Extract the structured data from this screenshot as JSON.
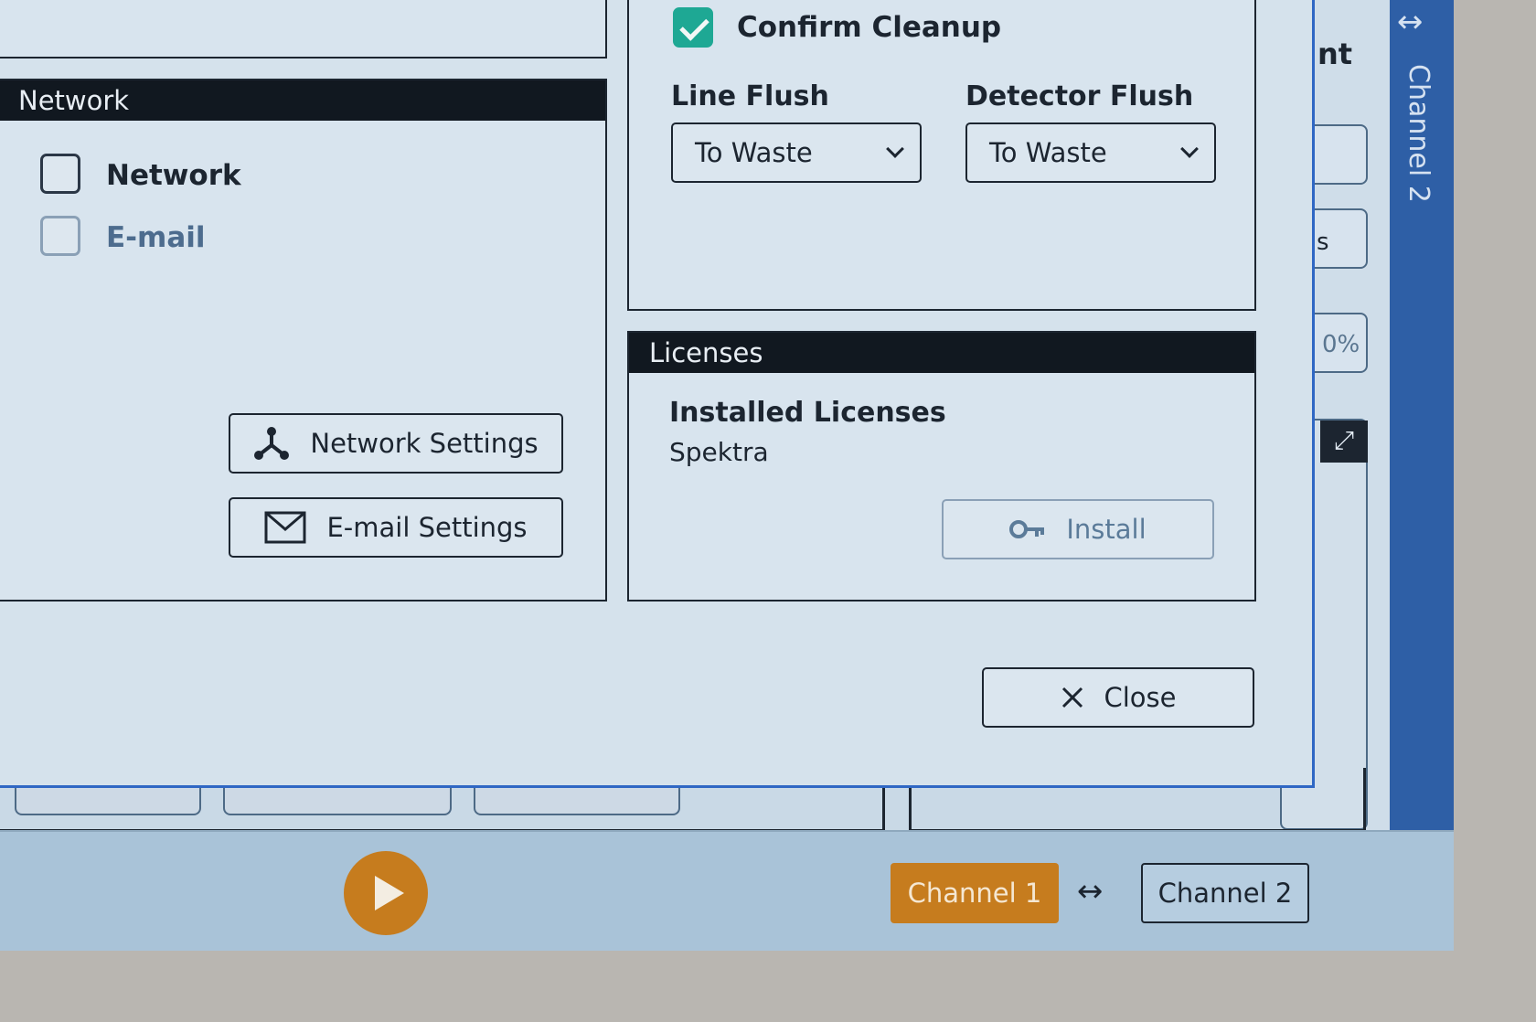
{
  "dialog": {
    "network_panel": {
      "header": "Network",
      "checkboxes": [
        {
          "label": "Network",
          "checked": false,
          "enabled": true
        },
        {
          "label": "E-mail",
          "checked": false,
          "enabled": false
        }
      ],
      "network_settings_label": "Network Settings",
      "email_settings_label": "E-mail Settings",
      "icons": {
        "network": "network-icon",
        "email": "envelope-icon"
      }
    },
    "cleanup_panel": {
      "confirm_label": "Confirm Cleanup",
      "confirm_checked": true,
      "line_flush": {
        "label": "Line Flush",
        "value": "To Waste"
      },
      "detector_flush": {
        "label": "Detector Flush",
        "value": "To Waste"
      }
    },
    "licenses_panel": {
      "header": "Licenses",
      "installed_title": "Installed Licenses",
      "installed_items": [
        "Spektra"
      ],
      "install_label": "Install",
      "install_enabled": false,
      "icons": {
        "install": "key-icon"
      }
    },
    "close_label": "Close"
  },
  "background": {
    "partial_text_top": "nt",
    "partial_text_mid": "s",
    "partial_percent": "0%",
    "side_rail_label": "Channel 2"
  },
  "bottom_bar": {
    "channel1_label": "Channel 1",
    "channel2_label": "Channel 2",
    "active_channel": "Channel 1"
  },
  "colors": {
    "accent_orange": "#c67c1e",
    "check_teal": "#1ea894",
    "dialog_border_blue": "#2f67c4",
    "header_dark": "#111820"
  }
}
